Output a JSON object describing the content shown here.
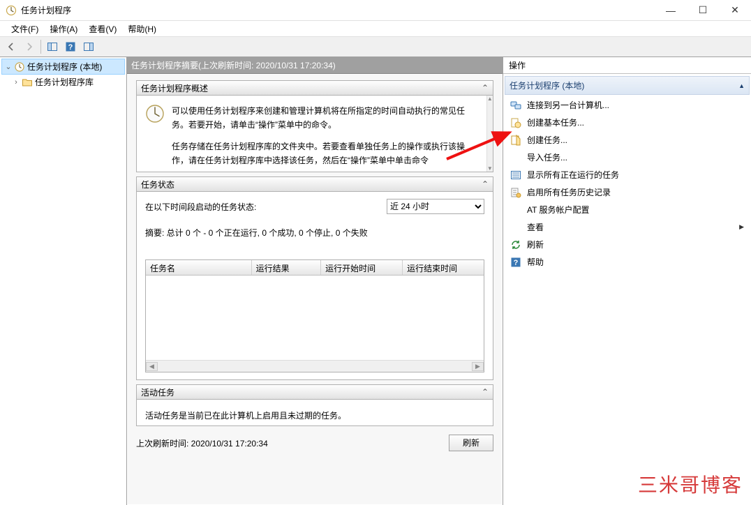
{
  "window": {
    "title": "任务计划程序",
    "minimize": "—",
    "maximize": "☐",
    "close": "✕"
  },
  "menu": {
    "file": "文件(F)",
    "action": "操作(A)",
    "view": "查看(V)",
    "help": "帮助(H)"
  },
  "tree": {
    "root": "任务计划程序 (本地)",
    "library": "任务计划程序库"
  },
  "center": {
    "header": "任务计划程序摘要(上次刷新时间: 2020/10/31 17:20:34)",
    "overview_title": "任务计划程序概述",
    "overview_p1": "可以使用任务计划程序来创建和管理计算机将在所指定的时间自动执行的常见任务。若要开始，请单击“操作”菜单中的命令。",
    "overview_p2": "任务存储在任务计划程序库的文件夹中。若要查看单独任务上的操作或执行该操作，请在任务计划程序库中选择该任务，然后在“操作”菜单中单击命令",
    "status_title": "任务状态",
    "status_period_label": "在以下时间段启动的任务状态:",
    "status_period_value": "近 24 小时",
    "status_summary": "摘要: 总计 0 个 - 0 个正在运行, 0 个成功, 0 个停止, 0 个失败",
    "col_name": "任务名",
    "col_result": "运行结果",
    "col_start": "运行开始时间",
    "col_end": "运行结束时间",
    "active_title": "活动任务",
    "active_desc": "活动任务是当前已在此计算机上启用且未过期的任务。",
    "last_refresh": "上次刷新时间: 2020/10/31 17:20:34",
    "refresh_btn": "刷新"
  },
  "actions": {
    "pane_title": "操作",
    "group_title": "任务计划程序 (本地)",
    "items": {
      "connect": "连接到另一台计算机...",
      "create_basic": "创建基本任务...",
      "create_task": "创建任务...",
      "import": "导入任务...",
      "show_running": "显示所有正在运行的任务",
      "enable_history": "启用所有任务历史记录",
      "at_config": "AT 服务帐户配置",
      "view": "查看",
      "refresh": "刷新",
      "help": "帮助"
    }
  },
  "watermark": "三米哥博客"
}
